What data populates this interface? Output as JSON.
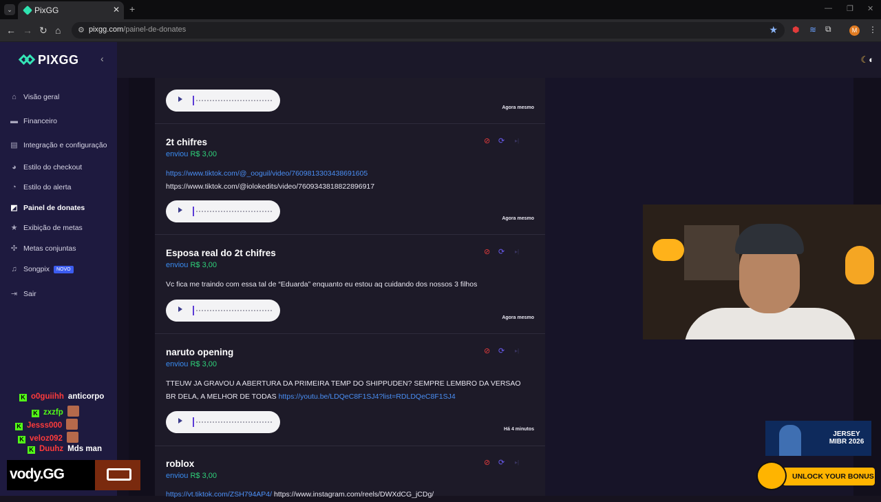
{
  "browser": {
    "tab_title": "PixGG",
    "url_host": "pixgg.com",
    "url_path": "/painel-de-donates",
    "avatar_initial": "M"
  },
  "sidebar": {
    "logo": "PIXGG",
    "items": [
      {
        "label": "Visão geral",
        "icon": "home-icon"
      },
      {
        "label": "Financeiro",
        "icon": "wallet-icon"
      },
      {
        "label": "Integração e configuração",
        "icon": "settings-icon"
      },
      {
        "label": "Estilo do checkout",
        "icon": "palette-icon"
      },
      {
        "label": "Estilo do alerta",
        "icon": "alert-icon"
      },
      {
        "label": "Painel de donates",
        "icon": "chart-icon"
      },
      {
        "label": "Exibição de metas",
        "icon": "star-icon"
      },
      {
        "label": "Metas conjuntas",
        "icon": "group-icon"
      },
      {
        "label": "Songpix",
        "icon": "music-icon",
        "badge": "NOVO"
      },
      {
        "label": "Sair",
        "icon": "logout-icon"
      }
    ]
  },
  "donations": [
    {
      "title": "",
      "sent_label": "",
      "amount": "",
      "time": "Agora mesmo"
    },
    {
      "title": "2t chifres",
      "sent_label": "enviou",
      "amount": "R$ 3,00",
      "link1": "https://www.tiktok.com/@_ooguil/video/7609813303438691605",
      "text2": "https://www.tiktok.com/@iolokedits/video/7609343818822896917",
      "time": "Agora mesmo"
    },
    {
      "title": "Esposa real do 2t chifres",
      "sent_label": "enviou",
      "amount": "R$ 3,00",
      "message": "Vc fica me traindo com essa tal de “Eduarda” enquanto eu estou aq cuidando dos nossos 3 filhos",
      "time": "Agora mesmo"
    },
    {
      "title": "naruto opening",
      "sent_label": "enviou",
      "amount": "R$ 3,00",
      "message_line1": "TTEUW JA GRAVOU A ABERTURA DA PRIMEIRA TEMP DO SHIPPUDEN? SEMPRE LEMBRO DA VERSAO",
      "message_line2": "BR DELA, A MELHOR DE TODAS",
      "link": "https://youtu.be/LDQeC8F1SJ4?list=RDLDQeC8F1SJ4",
      "time": "Há 4 minutos"
    },
    {
      "title": "roblox",
      "sent_label": "enviou",
      "amount": "R$ 3,00",
      "link1": "https://vt.tiktok.com/ZSH794AP4/",
      "text2": "https://www.instagram.com/reels/DWXdCG_jCDg/"
    }
  ],
  "chat": [
    {
      "user": "o0guiihh",
      "message": "anticorpo",
      "user_color": "#ff3b3b"
    },
    {
      "user": "zxzfp",
      "message": "",
      "user_color": "#53fc18"
    },
    {
      "user": "Jesss000",
      "message": "",
      "user_color": "#ff3b3b"
    },
    {
      "user": "veloz092",
      "message": "",
      "user_color": "#ff3b3b"
    },
    {
      "user": "Duuhz",
      "message": "Mds man",
      "user_color": "#ff3b3b"
    }
  ],
  "overlays": {
    "vody": "vody.GG",
    "promo_line1": "JERSEY",
    "promo_line2": "MIBR 2026",
    "unlock": "UNLOCK YOUR BONUS"
  },
  "colors": {
    "accent": "#35e3b5",
    "sidebar_bg": "#1e1a3f",
    "amount_green": "#2fd17a",
    "link_blue": "#4a8ff5"
  }
}
